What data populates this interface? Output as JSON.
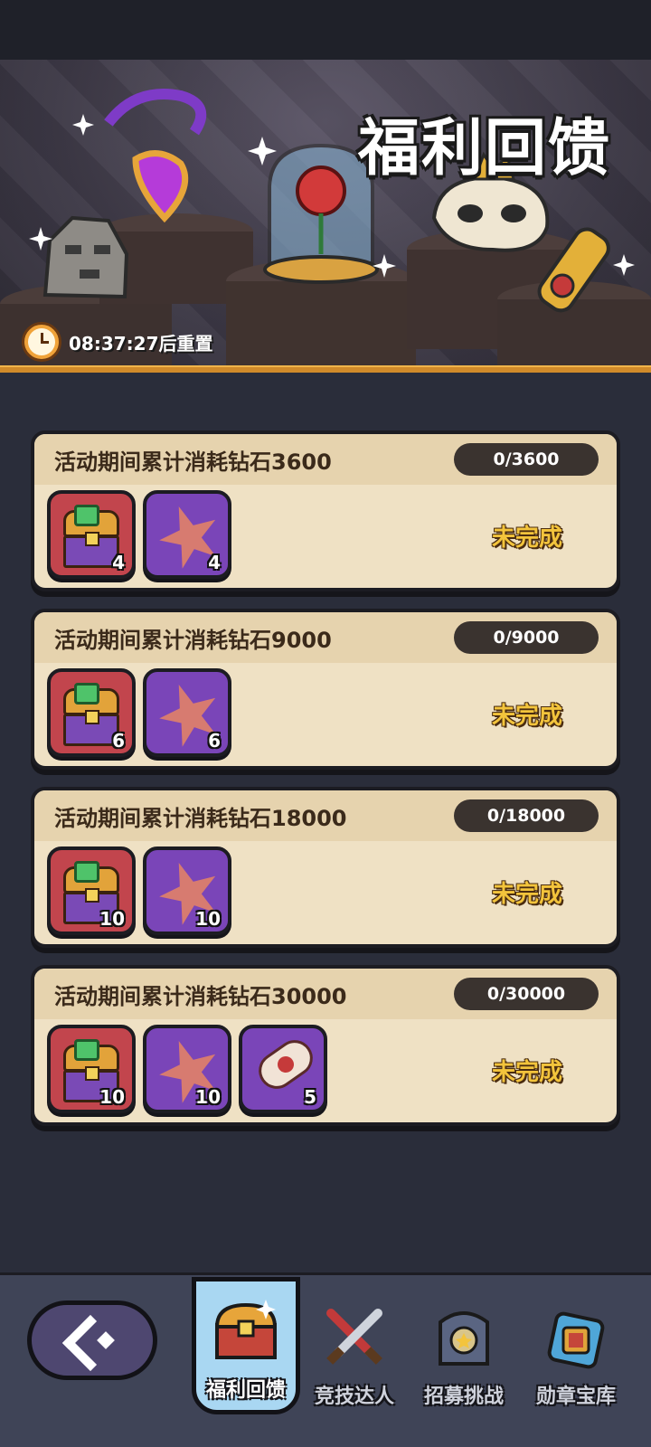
{
  "banner": {
    "title": "福利回馈",
    "timer": "08:37:27后重置"
  },
  "tasks": [
    {
      "title": "活动期间累计消耗钻石3600",
      "progress": "0/3600",
      "status": "未完成",
      "rewards": [
        {
          "icon": "treasure-chest",
          "count": "4"
        },
        {
          "icon": "star-shard",
          "count": "4"
        }
      ]
    },
    {
      "title": "活动期间累计消耗钻石9000",
      "progress": "0/9000",
      "status": "未完成",
      "rewards": [
        {
          "icon": "treasure-chest",
          "count": "6"
        },
        {
          "icon": "star-shard",
          "count": "6"
        }
      ]
    },
    {
      "title": "活动期间累计消耗钻石18000",
      "progress": "0/18000",
      "status": "未完成",
      "rewards": [
        {
          "icon": "treasure-chest",
          "count": "10"
        },
        {
          "icon": "star-shard",
          "count": "10"
        }
      ]
    },
    {
      "title": "活动期间累计消耗钻石30000",
      "progress": "0/30000",
      "status": "未完成",
      "rewards": [
        {
          "icon": "treasure-chest",
          "count": "10"
        },
        {
          "icon": "star-shard",
          "count": "10"
        },
        {
          "icon": "scroll",
          "count": "5"
        }
      ]
    }
  ],
  "nav": {
    "back_icon": "back-arrow",
    "tabs": [
      {
        "label": "福利回馈",
        "icon": "chest",
        "active": true
      },
      {
        "label": "竞技达人",
        "icon": "crossed-swords",
        "active": false
      },
      {
        "label": "招募挑战",
        "icon": "recruit-banner",
        "active": false
      },
      {
        "label": "勋章宝库",
        "icon": "medal-box",
        "active": false
      }
    ]
  },
  "colors": {
    "card_bg": "#efe1c4",
    "status": "#f3c43c",
    "accent_orange": "#d08a2a",
    "nav_active": "#a9d7f2"
  }
}
